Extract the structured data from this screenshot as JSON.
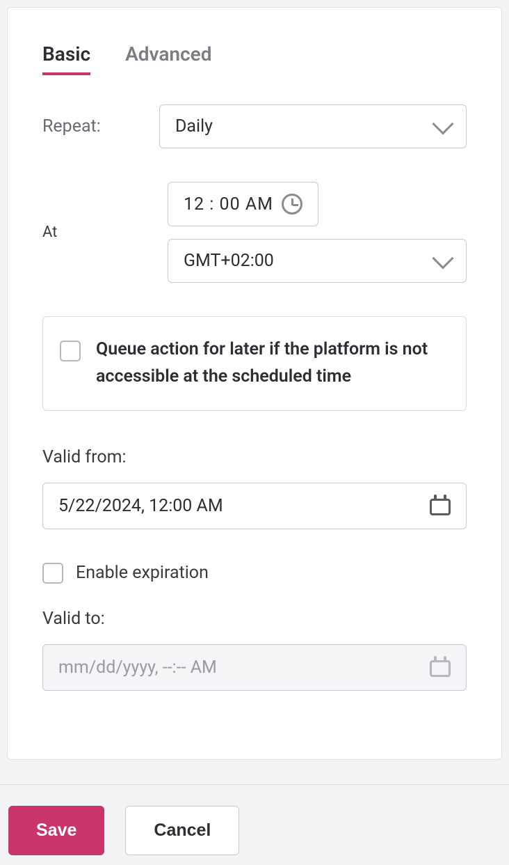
{
  "tabs": {
    "basic": "Basic",
    "advanced": "Advanced"
  },
  "repeat": {
    "label": "Repeat:",
    "value": "Daily"
  },
  "at": {
    "label": "At",
    "time_display": "12 : 00  AM",
    "timezone": "GMT+02:00"
  },
  "queue": {
    "text": "Queue action for later if the platform is not accessible at the scheduled time"
  },
  "valid_from": {
    "label": "Valid from:",
    "value": "5/22/2024, 12:00 AM"
  },
  "expiration": {
    "enable_label": "Enable expiration",
    "valid_to_label": "Valid to:",
    "placeholder": "mm/dd/yyyy, --:-- AM"
  },
  "footer": {
    "save": "Save",
    "cancel": "Cancel"
  }
}
